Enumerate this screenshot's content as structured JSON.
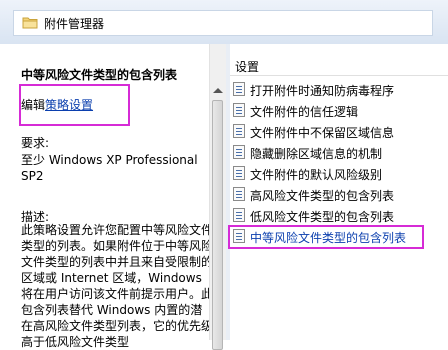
{
  "window": {
    "title": "附件管理器"
  },
  "left": {
    "policy_title": "中等风险文件类型的包含列表",
    "edit_prefix": "编辑",
    "edit_link": "策略设置",
    "requirements_label": "要求:",
    "requirements_value": "至少 Windows XP Professional SP2",
    "description_label": "描述:",
    "description_text": "此策略设置允许您配置中等风险文件类型的列表。如果附件位于中等风险文件类型的列表中并且来自受限制的区域或 Internet 区域，Windows 将在用户访问该文件前提示用户。此包含列表替代 Windows 内置的潜在高风险文件类型列表，它的优先级高于低风险文件类型"
  },
  "right": {
    "column_header": "设置",
    "items": [
      {
        "label": "打开附件时通知防病毒程序"
      },
      {
        "label": "文件附件的信任逻辑"
      },
      {
        "label": "文件附件中不保留区域信息"
      },
      {
        "label": "隐藏删除区域信息的机制"
      },
      {
        "label": "文件附件的默认风险级别"
      },
      {
        "label": "高风险文件类型的包含列表"
      },
      {
        "label": "低风险文件类型的包含列表"
      },
      {
        "label": "中等风险文件类型的包含列表"
      }
    ],
    "selected_index": 7
  },
  "colors": {
    "highlight": "#d62bd6",
    "link": "#0b3fae"
  },
  "icons": {
    "title": "folder-icon",
    "list_item": "policy-setting-icon"
  }
}
